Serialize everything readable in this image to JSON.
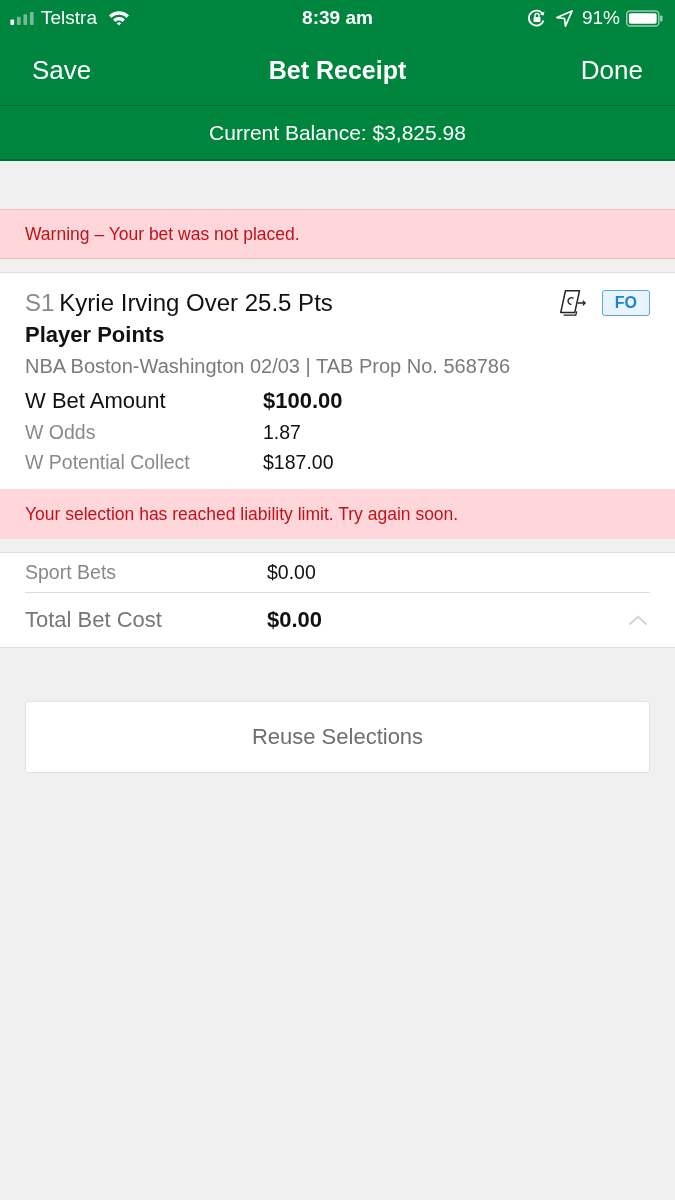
{
  "status_bar": {
    "carrier": "Telstra",
    "time": "8:39 am",
    "battery": "91%"
  },
  "nav": {
    "left": "Save",
    "title": "Bet Receipt",
    "right": "Done"
  },
  "balance": "Current Balance: $3,825.98",
  "warning": "Warning – Your bet was not placed.",
  "bet": {
    "number": "S1",
    "title": "Kyrie Irving Over 25.5 Pts",
    "badge": "FO",
    "market": "Player Points",
    "event": "NBA Boston-Washington 02/03 | TAB Prop No. 568786",
    "rows": [
      {
        "kind": "primary",
        "label": "W Bet Amount",
        "value": "$100.00"
      },
      {
        "kind": "secondary",
        "label": "W Odds",
        "value": "1.87"
      },
      {
        "kind": "secondary",
        "label": "W Potential Collect",
        "value": "$187.00"
      }
    ],
    "error": "Your selection has reached liability limit. Try again soon."
  },
  "summary": {
    "rows": [
      {
        "kind": "secondary",
        "label": "Sport Bets",
        "value": "$0.00"
      },
      {
        "kind": "total",
        "label": "Total Bet Cost",
        "value": "$0.00"
      }
    ]
  },
  "actions": [
    {
      "label": "Reuse Selections"
    }
  ]
}
